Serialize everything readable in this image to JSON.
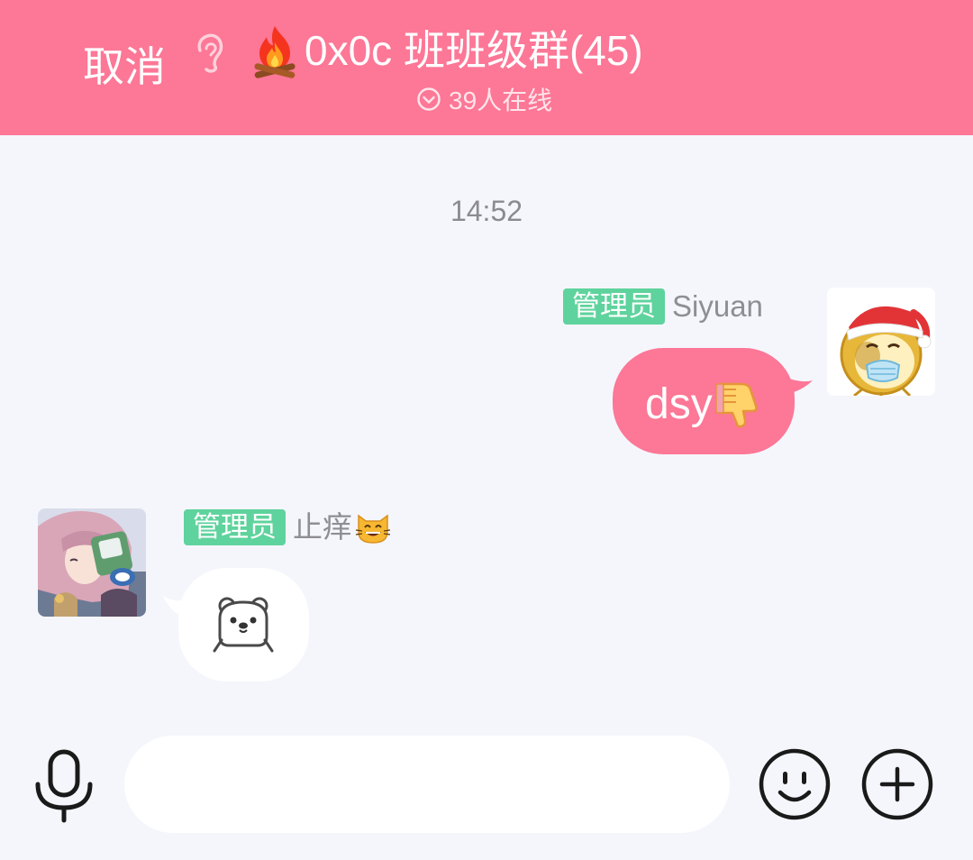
{
  "header": {
    "cancel_label": "取消",
    "title": "0x0c 班班级群(45)",
    "online_status": "39人在线",
    "colors": {
      "bar": "#fd7796",
      "text": "#ffffff"
    },
    "icons": {
      "ear": "ear-icon",
      "title_emoji": "fire-icon",
      "online": "chevron-down-circle-icon"
    }
  },
  "chat": {
    "time_divider": "14:52",
    "messages": [
      {
        "side": "right",
        "role_badge": "管理员",
        "sender": "Siyuan",
        "text": "dsy",
        "emoji": "thumbs-down-icon",
        "avatar": "lion-santa-mask-avatar",
        "bubble_color": "#fd7796"
      },
      {
        "side": "left",
        "role_badge": "管理员",
        "sender": "止痒",
        "sender_emoji": "grinning-cat-icon",
        "sticker": "polar-bear-icon",
        "avatar": "anime-girl-avatar",
        "bubble_color": "#ffffff"
      }
    ]
  },
  "input_bar": {
    "input_value": "",
    "icons": {
      "voice": "microphone-icon",
      "emoji": "smiley-icon",
      "more": "plus-icon"
    }
  },
  "colors": {
    "background": "#f5f6fc",
    "badge": "#5fd39d",
    "muted_text": "#8e8e93"
  }
}
